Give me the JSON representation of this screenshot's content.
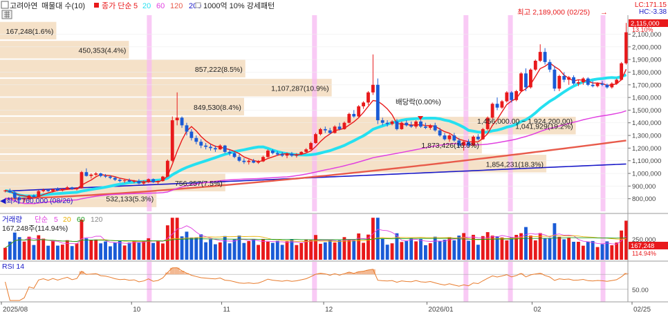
{
  "header": {
    "stock_name": "고려아연",
    "title_rest": "매물대 수(10)",
    "ma_label": "종가 단순",
    "ma_periods": [
      "5",
      "20",
      "60",
      "120",
      "200"
    ],
    "ma_colors": [
      "#e8191b",
      "#25e0f0",
      "#e040e0",
      "#e85a4a",
      "#1818c8"
    ],
    "pattern_label": "1000억 10% 강세패턴",
    "lc": "LC:171.15",
    "hc": "HC:-3.38"
  },
  "annotations": {
    "high": "최고 2,189,000 (02/25)",
    "low": "최저 760,000 (08/26)",
    "dividend": "배당락(0.00%)",
    "range_box": "1,456,000.00 ~ 1,924,200.00)",
    "current_price": "2,115,000",
    "current_pct": "13.10%"
  },
  "chart_data": [
    {
      "type": "candlestick",
      "ylim": [
        700000,
        2250000
      ],
      "y_ticks": [
        {
          "v": 800000,
          "label": "800,000"
        },
        {
          "v": 900000,
          "label": "900,000"
        },
        {
          "v": 1000000,
          "label": "1,000,000"
        },
        {
          "v": 1100000,
          "label": "1,100,000"
        },
        {
          "v": 1200000,
          "label": "1,200,000"
        },
        {
          "v": 1300000,
          "label": "1,300,000"
        },
        {
          "v": 1400000,
          "label": "1,400,000"
        },
        {
          "v": 1500000,
          "label": "1,500,000"
        },
        {
          "v": 1600000,
          "label": "1,600,000"
        },
        {
          "v": 1700000,
          "label": "1,700,000"
        },
        {
          "v": 1800000,
          "label": "1,800,000"
        },
        {
          "v": 1900000,
          "label": "1,900,000"
        },
        {
          "v": 2000000,
          "label": "2,000,000"
        },
        {
          "v": 2100000,
          "label": "2,100,000"
        }
      ],
      "x_ticks": [
        "2025/08",
        "10",
        "11",
        "12",
        "2026/01",
        "02",
        "02/25"
      ],
      "volume_profile": [
        {
          "price": 2125000,
          "label": "167,248(1.6%)",
          "width": 0.09
        },
        {
          "price": 1975000,
          "label": "450,353(4.4%)",
          "width": 0.206
        },
        {
          "price": 1825000,
          "label": "857,222(8.5%)",
          "width": 0.392
        },
        {
          "price": 1675000,
          "label": "1,107,287(10.9%)",
          "width": 0.53
        },
        {
          "price": 1525000,
          "label": "849,530(8.4%)",
          "width": 0.39
        },
        {
          "price": 1375000,
          "label": "1,041,929(19.2%)",
          "width": 0.92
        },
        {
          "price": 1225000,
          "label": "1,873,426(16.0%)",
          "width": 0.77
        },
        {
          "price": 1075000,
          "label": "1,854,231(18.3%)",
          "width": 0.873
        },
        {
          "price": 925000,
          "label": "756,257(7.5%)",
          "width": 0.36
        },
        {
          "price": 800000,
          "label": "532,133(5.3%)",
          "width": 0.25
        }
      ],
      "candles": [
        [
          860000,
          870000,
          850000,
          865000
        ],
        [
          865000,
          880000,
          845000,
          850000
        ],
        [
          850000,
          860000,
          800000,
          810000
        ],
        [
          810000,
          820000,
          760000,
          790000
        ],
        [
          790000,
          800000,
          770000,
          795000
        ],
        [
          795000,
          830000,
          790000,
          825000
        ],
        [
          825000,
          835000,
          810000,
          815000
        ],
        [
          815000,
          870000,
          812000,
          860000
        ],
        [
          860000,
          880000,
          850000,
          870000
        ],
        [
          870000,
          875000,
          855000,
          860000
        ],
        [
          860000,
          880000,
          850000,
          875000
        ],
        [
          875000,
          890000,
          860000,
          865000
        ],
        [
          865000,
          880000,
          858000,
          878000
        ],
        [
          878000,
          900000,
          870000,
          890000
        ],
        [
          890000,
          895000,
          870000,
          875000
        ],
        [
          875000,
          890000,
          865000,
          885000
        ],
        [
          885000,
          1020000,
          880000,
          1010000
        ],
        [
          1010000,
          1040000,
          975000,
          980000
        ],
        [
          980000,
          1000000,
          960000,
          990000
        ],
        [
          990000,
          1010000,
          980000,
          1000000
        ],
        [
          1000000,
          1005000,
          970000,
          980000
        ],
        [
          980000,
          995000,
          965000,
          975000
        ],
        [
          975000,
          985000,
          955000,
          965000
        ],
        [
          965000,
          975000,
          940000,
          950000
        ],
        [
          950000,
          960000,
          930000,
          940000
        ],
        [
          940000,
          955000,
          925000,
          945000
        ],
        [
          945000,
          960000,
          930000,
          935000
        ],
        [
          935000,
          948000,
          922000,
          940000
        ],
        [
          940000,
          955000,
          915000,
          920000
        ],
        [
          920000,
          945000,
          910000,
          930000
        ],
        [
          930000,
          960000,
          925000,
          955000
        ],
        [
          955000,
          960000,
          925000,
          930000
        ],
        [
          930000,
          945000,
          915000,
          940000
        ],
        [
          940000,
          980000,
          935000,
          975000
        ],
        [
          975000,
          1110000,
          970000,
          1100000
        ],
        [
          1100000,
          1450000,
          1090000,
          1420000
        ],
        [
          1420000,
          1640000,
          1380000,
          1440000
        ],
        [
          1440000,
          1450000,
          1360000,
          1380000
        ],
        [
          1380000,
          1400000,
          1300000,
          1330000
        ],
        [
          1330000,
          1350000,
          1260000,
          1280000
        ],
        [
          1280000,
          1300000,
          1230000,
          1250000
        ],
        [
          1250000,
          1270000,
          1200000,
          1220000
        ],
        [
          1220000,
          1240000,
          1190000,
          1210000
        ],
        [
          1210000,
          1230000,
          1180000,
          1200000
        ],
        [
          1200000,
          1220000,
          1170000,
          1190000
        ],
        [
          1190000,
          1230000,
          1185000,
          1220000
        ],
        [
          1220000,
          1225000,
          1160000,
          1170000
        ],
        [
          1170000,
          1190000,
          1140000,
          1160000
        ],
        [
          1160000,
          1175000,
          1120000,
          1130000
        ],
        [
          1130000,
          1150000,
          1090000,
          1100000
        ],
        [
          1100000,
          1120000,
          1075000,
          1090000
        ],
        [
          1090000,
          1110000,
          1070000,
          1100000
        ],
        [
          1100000,
          1115000,
          1080000,
          1085000
        ],
        [
          1085000,
          1105000,
          1075000,
          1095000
        ],
        [
          1095000,
          1140000,
          1090000,
          1130000
        ],
        [
          1130000,
          1190000,
          1125000,
          1180000
        ],
        [
          1180000,
          1190000,
          1150000,
          1160000
        ],
        [
          1160000,
          1175000,
          1140000,
          1150000
        ],
        [
          1150000,
          1170000,
          1130000,
          1140000
        ],
        [
          1140000,
          1165000,
          1120000,
          1155000
        ],
        [
          1155000,
          1170000,
          1130000,
          1140000
        ],
        [
          1140000,
          1160000,
          1125000,
          1150000
        ],
        [
          1150000,
          1175000,
          1145000,
          1170000
        ],
        [
          1170000,
          1200000,
          1165000,
          1190000
        ],
        [
          1190000,
          1250000,
          1185000,
          1240000
        ],
        [
          1240000,
          1320000,
          1235000,
          1310000
        ],
        [
          1310000,
          1360000,
          1300000,
          1350000
        ],
        [
          1350000,
          1370000,
          1320000,
          1340000
        ],
        [
          1340000,
          1360000,
          1310000,
          1320000
        ],
        [
          1320000,
          1380000,
          1315000,
          1370000
        ],
        [
          1370000,
          1400000,
          1340000,
          1350000
        ],
        [
          1350000,
          1410000,
          1345000,
          1400000
        ],
        [
          1400000,
          1480000,
          1395000,
          1470000
        ],
        [
          1470000,
          1500000,
          1440000,
          1450000
        ],
        [
          1450000,
          1540000,
          1445000,
          1530000
        ],
        [
          1530000,
          1570000,
          1510000,
          1560000
        ],
        [
          1560000,
          1650000,
          1540000,
          1640000
        ],
        [
          1640000,
          1940000,
          1620000,
          1700000
        ],
        [
          1700000,
          1750000,
          1390000,
          1420000
        ],
        [
          1420000,
          1440000,
          1380000,
          1400000
        ],
        [
          1400000,
          1420000,
          1370000,
          1390000
        ],
        [
          1390000,
          1420000,
          1380000,
          1410000
        ],
        [
          1410000,
          1430000,
          1340000,
          1350000
        ],
        [
          1350000,
          1410000,
          1345000,
          1400000
        ],
        [
          1400000,
          1420000,
          1370000,
          1380000
        ],
        [
          1380000,
          1410000,
          1360000,
          1370000
        ],
        [
          1370000,
          1420000,
          1355000,
          1410000
        ],
        [
          1410000,
          1420000,
          1360000,
          1370000
        ],
        [
          1370000,
          1400000,
          1350000,
          1360000
        ],
        [
          1360000,
          1390000,
          1345000,
          1380000
        ],
        [
          1380000,
          1400000,
          1330000,
          1340000
        ],
        [
          1340000,
          1360000,
          1290000,
          1300000
        ],
        [
          1300000,
          1320000,
          1260000,
          1270000
        ],
        [
          1270000,
          1310000,
          1250000,
          1300000
        ],
        [
          1300000,
          1320000,
          1250000,
          1260000
        ],
        [
          1260000,
          1280000,
          1200000,
          1220000
        ],
        [
          1220000,
          1260000,
          1180000,
          1250000
        ],
        [
          1250000,
          1270000,
          1210000,
          1220000
        ],
        [
          1220000,
          1300000,
          1215000,
          1290000
        ],
        [
          1290000,
          1310000,
          1260000,
          1270000
        ],
        [
          1270000,
          1360000,
          1265000,
          1350000
        ],
        [
          1350000,
          1450000,
          1340000,
          1440000
        ],
        [
          1440000,
          1560000,
          1430000,
          1550000
        ],
        [
          1550000,
          1600000,
          1500000,
          1520000
        ],
        [
          1520000,
          1580000,
          1510000,
          1570000
        ],
        [
          1570000,
          1650000,
          1560000,
          1640000
        ],
        [
          1640000,
          1650000,
          1560000,
          1580000
        ],
        [
          1580000,
          1660000,
          1570000,
          1650000
        ],
        [
          1650000,
          1800000,
          1640000,
          1790000
        ],
        [
          1790000,
          1830000,
          1650000,
          1680000
        ],
        [
          1680000,
          1830000,
          1670000,
          1820000
        ],
        [
          1820000,
          1900000,
          1810000,
          1890000
        ],
        [
          1890000,
          2020000,
          1880000,
          1960000
        ],
        [
          1960000,
          1990000,
          1860000,
          1880000
        ],
        [
          1880000,
          1900000,
          1800000,
          1820000
        ],
        [
          1820000,
          1850000,
          1650000,
          1670000
        ],
        [
          1670000,
          1780000,
          1650000,
          1770000
        ],
        [
          1770000,
          1800000,
          1720000,
          1740000
        ],
        [
          1740000,
          1770000,
          1700000,
          1760000
        ],
        [
          1760000,
          1775000,
          1700000,
          1710000
        ],
        [
          1710000,
          1740000,
          1690000,
          1720000
        ],
        [
          1720000,
          1760000,
          1700000,
          1750000
        ],
        [
          1750000,
          1760000,
          1690000,
          1700000
        ],
        [
          1700000,
          1730000,
          1680000,
          1690000
        ],
        [
          1690000,
          1720000,
          1680000,
          1710000
        ],
        [
          1710000,
          1730000,
          1690000,
          1700000
        ],
        [
          1700000,
          1710000,
          1670000,
          1680000
        ],
        [
          1680000,
          1720000,
          1670000,
          1710000
        ],
        [
          1710000,
          1750000,
          1700000,
          1740000
        ],
        [
          1740000,
          1880000,
          1735000,
          1870000
        ],
        [
          1870000,
          2189000,
          1860000,
          2115000
        ]
      ],
      "vol_ticks": [
        {
          "v": 250,
          "label": "250,000"
        }
      ],
      "volume_header": {
        "label": "거래량",
        "ma_label": "단순",
        "periods": [
          "5",
          "20",
          "60",
          "120"
        ],
        "colors": [
          "#e040e0",
          "#e8b000",
          "#1a9a1a",
          "#888888"
        ],
        "info": "167,248주(114.94%)"
      },
      "volume_current": {
        "value": "167,248",
        "pct": "114.94%"
      },
      "rsi": {
        "label": "RSI 14",
        "tick": "50.00",
        "threshold_hi": 70,
        "threshold_lo": 30
      }
    }
  ]
}
